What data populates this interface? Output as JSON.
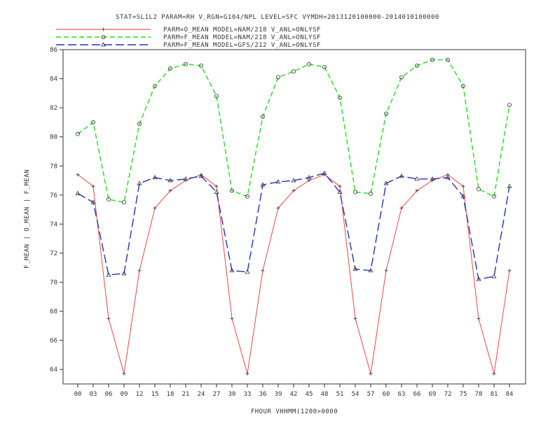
{
  "chart_data": {
    "type": "line",
    "title": "STAT=SL1L2 PARAM=RH V_RGN=G104/NPL LEVEL=SFC VYMDH=2013120100000-2014010100000",
    "xlabel": "FHOUR VHHMM(1200>0000",
    "ylabel": "F_MEAN | O_MEAN | F_MEAN",
    "categories": [
      "00",
      "03",
      "06",
      "09",
      "12",
      "15",
      "18",
      "21",
      "24",
      "27",
      "30",
      "33",
      "36",
      "39",
      "42",
      "45",
      "48",
      "51",
      "54",
      "57",
      "60",
      "63",
      "66",
      "69",
      "72",
      "75",
      "78",
      "81",
      "84"
    ],
    "yticks": [
      "64",
      "66",
      "68",
      "70",
      "72",
      "74",
      "76",
      "78",
      "80",
      "82",
      "84",
      "86"
    ],
    "ylim": [
      63,
      86
    ],
    "grid": false,
    "legend_position": "top-left",
    "series": [
      {
        "name": "PARM=O_MEAN MODEL=NAM/218 V_ANL=ONLYSF",
        "color": "#ee3333",
        "style": "solid",
        "marker": "plus",
        "values": [
          77.4,
          76.6,
          67.5,
          63.7,
          70.8,
          75.1,
          76.3,
          77.0,
          77.4,
          76.6,
          67.5,
          63.7,
          70.8,
          75.1,
          76.3,
          77.0,
          77.4,
          76.6,
          67.5,
          63.7,
          70.8,
          75.1,
          76.3,
          77.0,
          77.4,
          76.6,
          67.5,
          63.7,
          70.8
        ]
      },
      {
        "name": "PARM=F_MEAN MODEL=NAM/218 V_ANL=ONLYSF",
        "color": "#22dd22",
        "style": "dashed",
        "marker": "circle",
        "values": [
          80.2,
          81.0,
          75.7,
          75.5,
          80.9,
          83.5,
          84.7,
          85.0,
          84.9,
          82.8,
          76.3,
          75.9,
          81.4,
          84.1,
          84.5,
          85.0,
          84.8,
          82.7,
          76.2,
          76.1,
          81.6,
          84.1,
          84.9,
          85.3,
          85.3,
          83.5,
          76.4,
          75.9,
          82.2
        ]
      },
      {
        "name": "PARM=F_MEAN MODEL=GFS/212 V_ANL=ONLYSF",
        "color": "#2233bb",
        "style": "longdash",
        "marker": "triangle",
        "values": [
          76.1,
          75.5,
          70.5,
          70.6,
          76.8,
          77.2,
          77.0,
          77.1,
          77.3,
          76.2,
          70.8,
          70.7,
          76.7,
          76.9,
          77.0,
          77.2,
          77.5,
          76.2,
          70.9,
          70.8,
          76.8,
          77.3,
          77.1,
          77.1,
          77.2,
          75.9,
          70.2,
          70.4,
          76.6
        ]
      }
    ]
  }
}
